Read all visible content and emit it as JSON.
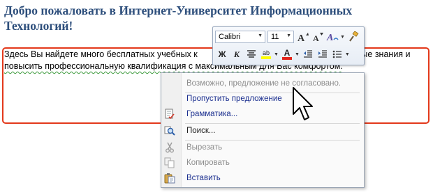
{
  "document": {
    "title": "Добро пожаловать в Интернет-Университет Информационных Технологий!",
    "paragraph_line1_start": "Здесь Вы найдете много бесплатных учебных к",
    "paragraph_line1_end": "вые знания и",
    "paragraph_line2": "повысить профессиональную квалификация с максимальным для Вас комфортом."
  },
  "mini_toolbar": {
    "font_name": "Calibri",
    "font_size": "11",
    "grow_font_icon": "A-increase-icon",
    "shrink_font_icon": "A-decrease-icon",
    "styles_icon": "styles-icon",
    "format_painter_icon": "format-painter-icon",
    "bold_label": "Ж",
    "italic_label": "К",
    "highlight_label": "ab",
    "font_color_label": "A",
    "highlight_color": "#ffff00",
    "font_color": "#e3241b"
  },
  "context_menu": {
    "items": [
      {
        "label": "Возможно, предложение не согласовано.",
        "state": "disabled"
      },
      {
        "label": "Пропустить предложение",
        "state": "enabled"
      },
      {
        "label": "Грамматика...",
        "state": "enabled",
        "icon": "grammar-icon"
      },
      {
        "label": "Поиск...",
        "state": "enabled",
        "icon": "search-icon"
      },
      {
        "label": "Вырезать",
        "state": "disabled",
        "icon": "scissors-icon"
      },
      {
        "label": "Копировать",
        "state": "disabled",
        "icon": "copy-icon"
      },
      {
        "label": "Вставить",
        "state": "enabled",
        "icon": "paste-icon"
      }
    ]
  },
  "colors": {
    "title": "#2e4f7c",
    "highlight_border": "#e3381a",
    "menu_text_blue": "#1b2f8f"
  }
}
